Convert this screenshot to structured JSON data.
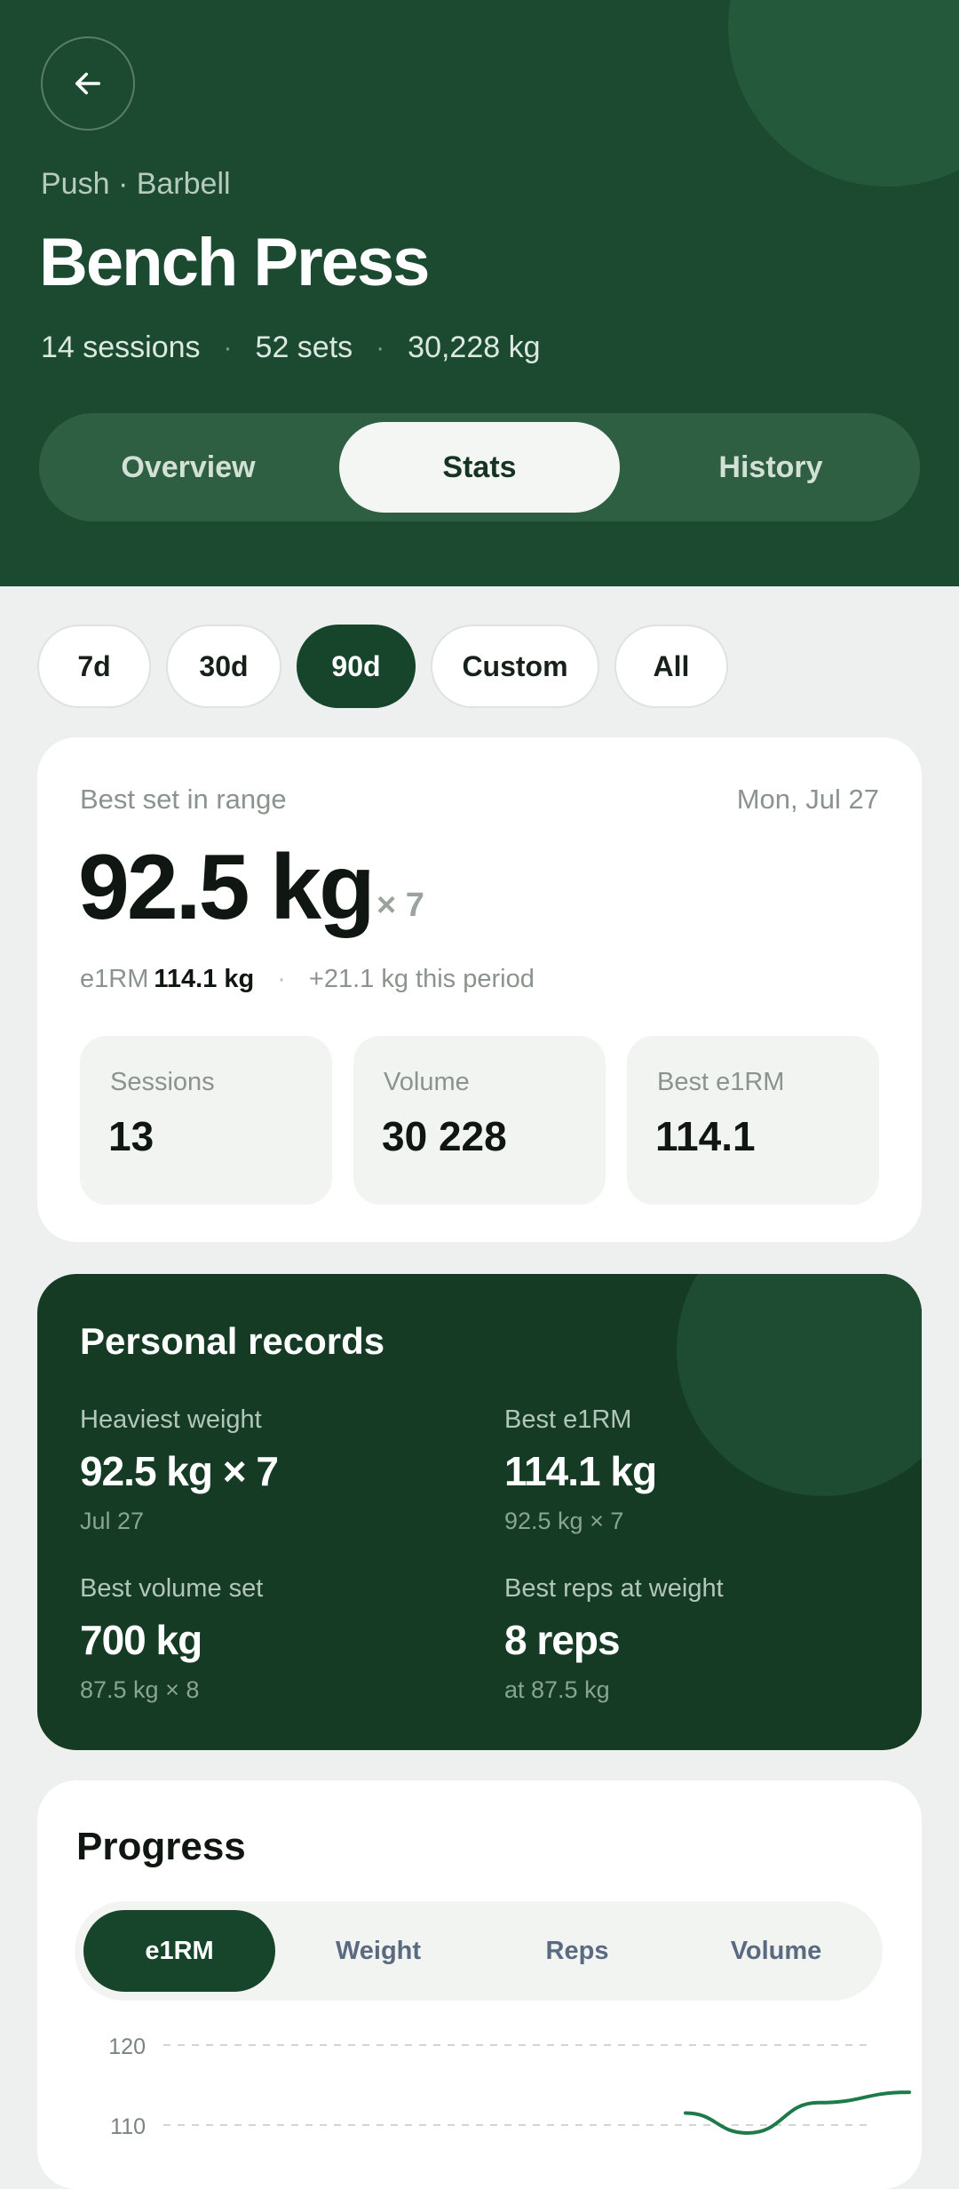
{
  "header": {
    "back_icon": "arrow-left-icon",
    "category": "Push · Barbell",
    "title": "Bench Press",
    "meta": [
      "14 sessions",
      "52 sets",
      "30,228 kg"
    ],
    "separator": "·",
    "tabs": [
      {
        "label": "Overview",
        "active": false
      },
      {
        "label": "Stats",
        "active": true
      },
      {
        "label": "History",
        "active": false
      }
    ]
  },
  "ranges": [
    {
      "label": "7d",
      "active": false
    },
    {
      "label": "30d",
      "active": false
    },
    {
      "label": "90d",
      "active": true
    },
    {
      "label": "Custom",
      "active": false
    },
    {
      "label": "All",
      "active": false
    }
  ],
  "best_set": {
    "label": "Best set in range",
    "date": "Mon, Jul 27",
    "weight": "92.5 kg",
    "reps": "× 7",
    "e1rm_label": "e1RM",
    "e1rm_value": "114.1 kg",
    "separator": "·",
    "change": "+21.1 kg this period",
    "stats": [
      {
        "label": "Sessions",
        "value": "13"
      },
      {
        "label": "Volume",
        "value": "30 228"
      },
      {
        "label": "Best e1RM",
        "value": "114.1"
      }
    ]
  },
  "records": {
    "title": "Personal records",
    "items": [
      {
        "label": "Heaviest weight",
        "value": "92.5 kg × 7",
        "sub": "Jul 27"
      },
      {
        "label": "Best e1RM",
        "value": "114.1 kg",
        "sub": "92.5 kg × 7"
      },
      {
        "label": "Best volume set",
        "value": "700 kg",
        "sub": "87.5 kg × 8"
      },
      {
        "label": "Best reps at weight",
        "value": "8 reps",
        "sub": "at 87.5 kg"
      }
    ]
  },
  "progress": {
    "title": "Progress",
    "metrics": [
      {
        "label": "e1RM",
        "active": true
      },
      {
        "label": "Weight",
        "active": false
      },
      {
        "label": "Reps",
        "active": false
      },
      {
        "label": "Volume",
        "active": false
      }
    ]
  },
  "chart_data": {
    "type": "line",
    "title": "",
    "xlabel": "",
    "ylabel": "",
    "y_ticks": [
      "120",
      "110"
    ],
    "ylim": [
      100,
      120
    ],
    "grid": true,
    "series": [
      {
        "values": [
          111.5,
          109.0,
          112.8,
          114.1
        ]
      }
    ],
    "line_color": "#1f7a4a"
  },
  "colors": {
    "header_bg": "#1b4a30",
    "accent": "#17452c",
    "page_bg": "#edf0ee"
  }
}
